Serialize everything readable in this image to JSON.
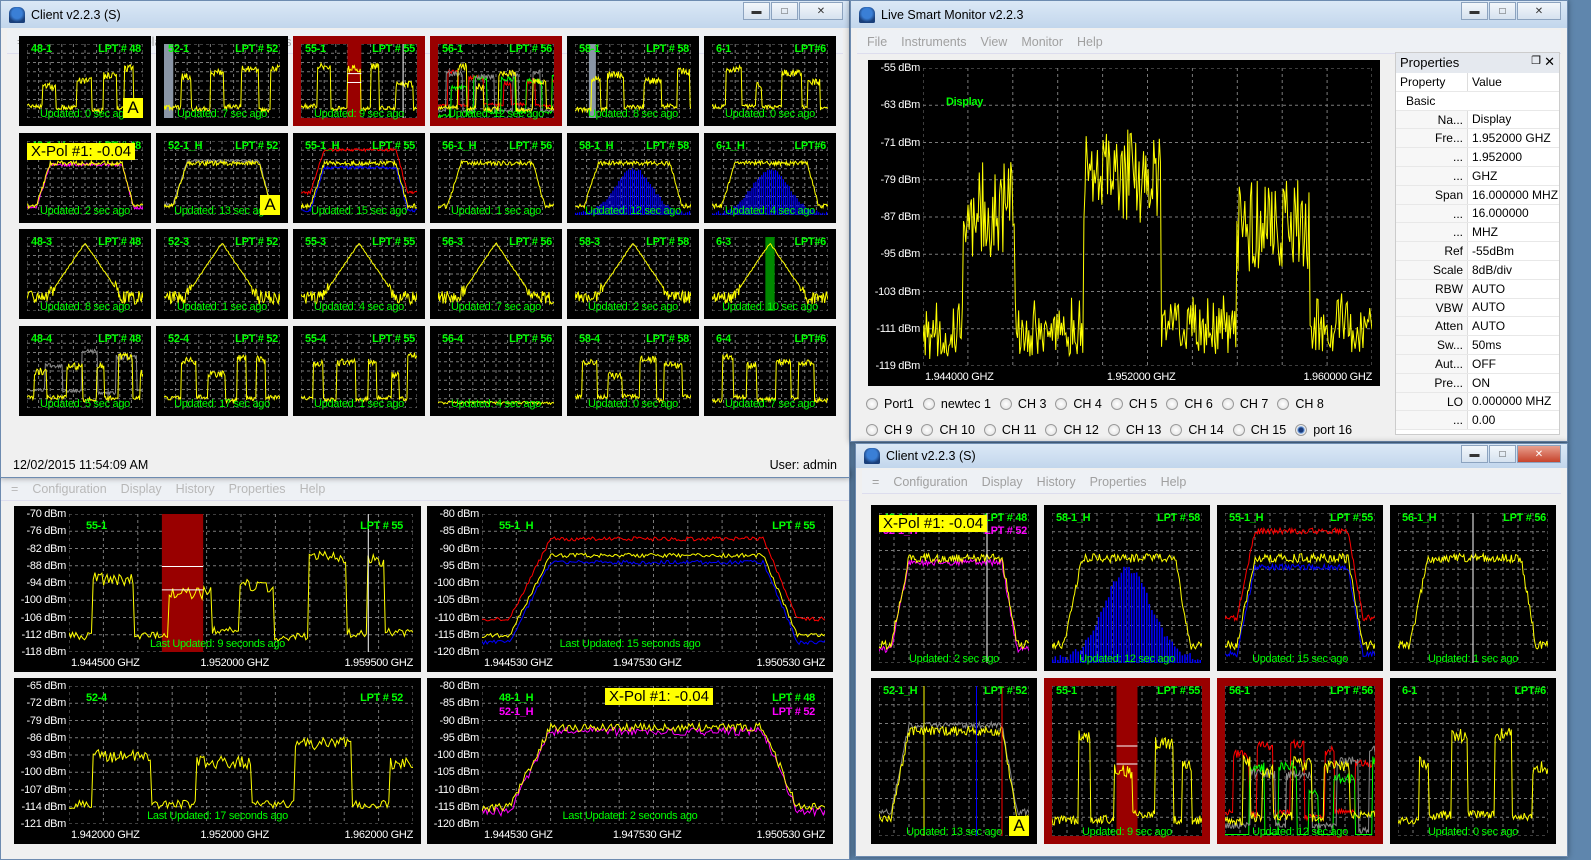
{
  "client1": {
    "title": "Client v2.2.3 (S)",
    "menu": [
      "=",
      "Configuration",
      "Display",
      "History",
      "Properties",
      "Help"
    ],
    "tiles": [
      {
        "title": "48-1",
        "lpt": "LPT # 48",
        "updated": "Updated: 0 sec ago",
        "alarm": false,
        "badge": "A"
      },
      {
        "title": "52-1",
        "lpt": "LPT # 52",
        "updated": "Updated: 7 sec ago",
        "alarm": false
      },
      {
        "title": "55-1",
        "lpt": "LPT # 55",
        "updated": "Updated: 9 sec ago",
        "alarm": true
      },
      {
        "title": "56-1",
        "lpt": "LPT # 56",
        "updated": "Updated: 12 sec ago",
        "alarm": true
      },
      {
        "title": "58-1",
        "lpt": "LPT # 58",
        "updated": "Updated: 8 sec ago",
        "alarm": false
      },
      {
        "title": "6-1",
        "lpt": "LPT#6",
        "updated": "Updated: 0 sec ago",
        "alarm": false
      },
      {
        "title": "48-1_H",
        "lpt": "LPT # 48",
        "updated": "Updated: 2 sec ago",
        "alarm": false,
        "xpol": "X-Pol #1: -0.04"
      },
      {
        "title": "52-1_H",
        "lpt": "LPT # 52",
        "updated": "Updated: 13 sec ago",
        "alarm": false,
        "badge": "A"
      },
      {
        "title": "55-1_H",
        "lpt": "LPT # 55",
        "updated": "Updated: 15 sec ago",
        "alarm": false
      },
      {
        "title": "56-1_H",
        "lpt": "LPT # 56",
        "updated": "Updated: 1 sec ago",
        "alarm": false
      },
      {
        "title": "58-1_H",
        "lpt": "LPT # 58",
        "updated": "Updated: 12 sec ago",
        "alarm": false
      },
      {
        "title": "6-1_H",
        "lpt": "LPT#6",
        "updated": "Updated: 4 sec ago",
        "alarm": false
      },
      {
        "title": "48-3",
        "lpt": "LPT # 48",
        "updated": "Updated: 8 sec ago",
        "alarm": false
      },
      {
        "title": "52-3",
        "lpt": "LPT # 52",
        "updated": "Updated: 1 sec ago",
        "alarm": false
      },
      {
        "title": "55-3",
        "lpt": "LPT # 55",
        "updated": "Updated: 4 sec ago",
        "alarm": false
      },
      {
        "title": "56-3",
        "lpt": "LPT # 56",
        "updated": "Updated: 7 sec ago",
        "alarm": false
      },
      {
        "title": "58-3",
        "lpt": "LPT # 58",
        "updated": "Updated: 2 sec ago",
        "alarm": false
      },
      {
        "title": "6-3",
        "lpt": "LPT#6",
        "updated": "Updated: 10 sec ago",
        "alarm": false
      },
      {
        "title": "48-4",
        "lpt": "LPT # 48",
        "updated": "Updated: 5 sec ago",
        "alarm": false
      },
      {
        "title": "52-4",
        "lpt": "LPT # 52",
        "updated": "Updated: 17 sec ago",
        "alarm": false
      },
      {
        "title": "55-4",
        "lpt": "LPT # 55",
        "updated": "Updated: 1 sec ago",
        "alarm": false
      },
      {
        "title": "56-4",
        "lpt": "LPT # 56",
        "updated": "Updated: 4 sec ago",
        "alarm": false
      },
      {
        "title": "58-4",
        "lpt": "LPT # 58",
        "updated": "Updated: 0 sec ago",
        "alarm": false
      },
      {
        "title": "6-4",
        "lpt": "LPT#6",
        "updated": "Updated: 7 sec ago",
        "alarm": false
      }
    ],
    "status_time": "12/02/2015 11:54:09 AM",
    "status_user": "User: admin"
  },
  "client_bg": {
    "menu": [
      "=",
      "Configuration",
      "Display",
      "History",
      "Properties",
      "Help"
    ],
    "panels": [
      {
        "title": "55-1",
        "lpt": "LPT # 55",
        "updated": "Last Updated: 9 seconds ago",
        "y_ticks": [
          "-70 dBm",
          "-76 dBm",
          "-82 dBm",
          "-88 dBm",
          "-94 dBm",
          "-100 dBm",
          "-106 dBm",
          "-112 dBm",
          "-118 dBm"
        ],
        "x_ticks": [
          "1.944500 GHZ",
          "1.952000 GHZ",
          "1.959500 GHZ"
        ]
      },
      {
        "title": "55-1_H",
        "lpt": "LPT # 55",
        "updated": "Last Updated: 15 seconds ago",
        "y_ticks": [
          "-80 dBm",
          "-85 dBm",
          "-90 dBm",
          "-95 dBm",
          "-100 dBm",
          "-105 dBm",
          "-110 dBm",
          "-115 dBm",
          "-120 dBm"
        ],
        "x_ticks": [
          "1.944530 GHZ",
          "1.947530 GHZ",
          "1.950530 GHZ"
        ]
      },
      {
        "title": "52-4",
        "lpt": "LPT # 52",
        "updated": "Last Updated: 17 seconds ago",
        "y_ticks": [
          "-65 dBm",
          "-72 dBm",
          "-79 dBm",
          "-86 dBm",
          "-93 dBm",
          "-100 dBm",
          "-107 dBm",
          "-114 dBm",
          "-121 dBm"
        ],
        "x_ticks": [
          "1.942000 GHZ",
          "1.952000 GHZ",
          "1.962000 GHZ"
        ]
      },
      {
        "title": "48-1_H",
        "lpt": "LPT # 48",
        "title2": "52-1_H",
        "lpt2": "LPT # 52",
        "xpol": "X-Pol #1: -0.04",
        "updated": "Last Updated: 2 seconds ago",
        "y_ticks": [
          "-80 dBm",
          "-85 dBm",
          "-90 dBm",
          "-95 dBm",
          "-100 dBm",
          "-105 dBm",
          "-110 dBm",
          "-115 dBm",
          "-120 dBm"
        ],
        "x_ticks": [
          "1.944530 GHZ",
          "1.947530 GHZ",
          "1.950530 GHZ"
        ]
      }
    ]
  },
  "monitor": {
    "title": "Live Smart Monitor v2.2.3",
    "menu": [
      "File",
      "Instruments",
      "View",
      "Monitor",
      "Help"
    ],
    "chart": {
      "label": "Display",
      "y_ticks": [
        "-55 dBm",
        "-63 dBm",
        "-71 dBm",
        "-79 dBm",
        "-87 dBm",
        "-95 dBm",
        "-103 dBm",
        "-111 dBm",
        "-119 dBm"
      ],
      "x_ticks": [
        "1.944000 GHZ",
        "1.952000 GHZ",
        "1.960000 GHZ"
      ]
    },
    "properties": {
      "title": "Properties",
      "col_property": "Property",
      "col_value": "Value",
      "rows": [
        {
          "k": "Basic",
          "v": "",
          "group": true
        },
        {
          "k": "Na...",
          "v": "Display"
        },
        {
          "k": "Fre...",
          "v": "1.952000 GHZ",
          "expand": true
        },
        {
          "k": "...",
          "v": "1.952000"
        },
        {
          "k": "...",
          "v": "GHZ"
        },
        {
          "k": "Span",
          "v": "16.000000 MHZ",
          "expand": true
        },
        {
          "k": "...",
          "v": "16.000000"
        },
        {
          "k": "...",
          "v": "MHZ"
        },
        {
          "k": "Ref",
          "v": "-55dBm"
        },
        {
          "k": "Scale",
          "v": "8dB/div"
        },
        {
          "k": "RBW",
          "v": "AUTO"
        },
        {
          "k": "VBW",
          "v": "AUTO"
        },
        {
          "k": "Atten",
          "v": "AUTO"
        },
        {
          "k": "Sw...",
          "v": "50ms"
        },
        {
          "k": "Aut...",
          "v": "OFF"
        },
        {
          "k": "Pre...",
          "v": "ON"
        },
        {
          "k": "LO",
          "v": "0.000000 MHZ",
          "expand": true
        },
        {
          "k": "...",
          "v": "0.00"
        }
      ]
    },
    "channels_row1": [
      "Port1",
      "newtec 1",
      "CH 3",
      "CH 4",
      "CH 5",
      "CH 6",
      "CH 7",
      "CH 8"
    ],
    "channels_row2": [
      "CH 9",
      "CH 10",
      "CH 11",
      "CH 12",
      "CH 13",
      "CH 14",
      "CH 15",
      "port 16"
    ],
    "selected_channel": "port 16"
  },
  "client2": {
    "title": "Client v2.2.3 (S)",
    "menu": [
      "=",
      "Configuration",
      "Display",
      "History",
      "Properties",
      "Help"
    ],
    "tiles": [
      {
        "title": "48-1_H",
        "lpt": "LPT # 48",
        "title2": "52-1_H",
        "lpt2": "LPT # 52",
        "updated": "Updated: 2 sec ago",
        "alarm": false,
        "xpol": "X-Pol #1: -0.04"
      },
      {
        "title": "58-1_H",
        "lpt": "LPT # 58",
        "updated": "Updated: 12 sec ago",
        "alarm": false
      },
      {
        "title": "55-1_H",
        "lpt": "LPT # 55",
        "updated": "Updated: 15 sec ago",
        "alarm": false
      },
      {
        "title": "56-1_H",
        "lpt": "LPT # 56",
        "updated": "Updated: 1 sec ago",
        "alarm": false
      },
      {
        "title": "52-1_H",
        "lpt": "LPT # 52",
        "updated": "Updated: 13 sec ago",
        "alarm": false,
        "badge": "A"
      },
      {
        "title": "55-1",
        "lpt": "LPT # 55",
        "updated": "Updated: 9 sec ago",
        "alarm": true
      },
      {
        "title": "56-1",
        "lpt": "LPT # 56",
        "updated": "Updated: 12 sec ago",
        "alarm": true
      },
      {
        "title": "6-1",
        "lpt": "LPT#6",
        "updated": "Updated: 0 sec ago",
        "alarm": false
      }
    ]
  },
  "colors": {
    "trace": "#ffff00",
    "label": "#00ff00",
    "alarm": "#990000",
    "highlight": "#ffff00"
  }
}
